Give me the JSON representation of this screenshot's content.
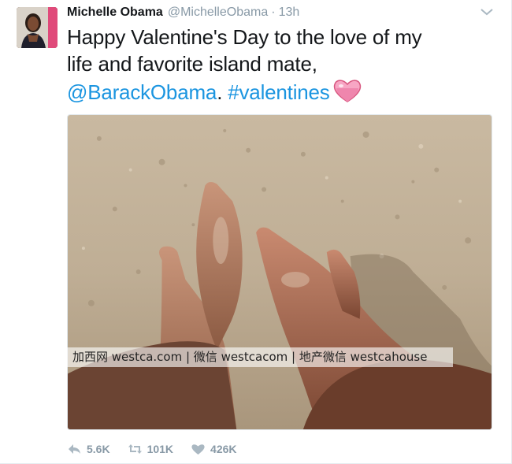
{
  "tweet": {
    "author_name": "Michelle Obama",
    "author_handle": "@MichelleObama",
    "separator": "·",
    "time": "13h",
    "text_line_1": "Happy Valentine's Day to the love of my",
    "text_line_2": "life and favorite island mate,",
    "mention": "@BarackObama",
    "mention_suffix": ".",
    "hashtag": "#valentines",
    "emoji_icon": "pink-heart-icon"
  },
  "media": {
    "watermark": "加西网 westca.com | 微信 westcacom | 地产微信 westcahouse"
  },
  "actions": {
    "reply_icon": "reply-arrow-icon",
    "reply_count": "5.6K",
    "retweet_icon": "retweet-icon",
    "retweet_count": "101K",
    "like_icon": "heart-icon",
    "like_count": "426K"
  },
  "colors": {
    "link": "#1b95e0",
    "muted": "#8899a6",
    "text": "#14171a",
    "heart_pink": "#f7a6c4"
  }
}
